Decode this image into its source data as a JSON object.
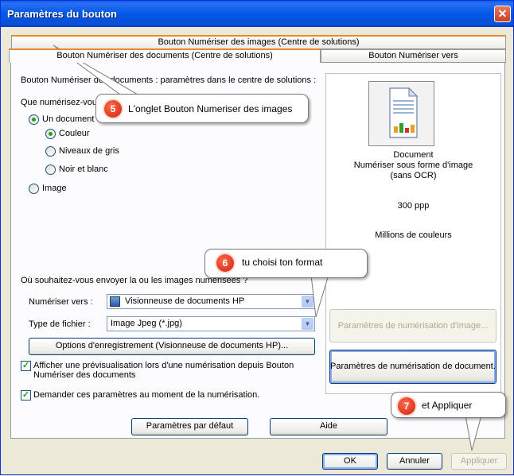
{
  "window": {
    "title": "Paramètres du bouton",
    "close_label": "✕"
  },
  "tabs": {
    "top": "Bouton Numériser des images (Centre de solutions)",
    "selected": "Bouton Numériser des documents (Centre de solutions)",
    "right": "Bouton Numériser vers"
  },
  "panel": {
    "heading": "Bouton Numériser des documents : paramètres dans le centre de solutions :",
    "question": "Que numérisez-vous",
    "radio_document": "Un document",
    "radio_couleur": "Couleur",
    "radio_gris": "Niveaux de gris",
    "radio_noir": "Noir et blanc",
    "radio_image": "Image",
    "send_question": "Où souhaitez-vous envoyer la ou les images numérisées ?",
    "scan_to_label": "Numériser vers :",
    "scan_to_value": "Visionneuse de documents HP",
    "file_type_label": "Type de fichier :",
    "file_type_value": "Image Jpeg (*.jpg)",
    "save_options_button": "Options d'enregistrement (Visionneuse de documents HP)...",
    "preview_check_label_1": "Afficher une prévisualisation lors d'une numérisation depuis Bouton",
    "preview_check_label_2": "Numériser des documents",
    "ask_check_label": "Demander ces paramètres au moment de la numérisation.",
    "defaults_button": "Paramètres par défaut",
    "help_button": "Aide"
  },
  "preview": {
    "line1": "Document",
    "line2": "Numériser sous forme d'image",
    "line3": "(sans OCR)",
    "resolution": "300 ppp",
    "colors": "Millions de couleurs",
    "image_settings_button": "Paramètres de numérisation d'image...",
    "doc_settings_button": "Paramètres de numérisation de document..."
  },
  "footer": {
    "ok": "OK",
    "cancel": "Annuler",
    "apply": "Appliquer"
  },
  "callouts": [
    {
      "number": "5",
      "text": "L'onglet Bouton Numeriser des images"
    },
    {
      "number": "6",
      "text": "tu choisi ton format"
    },
    {
      "number": "7",
      "text": "et Appliquer"
    }
  ],
  "icon_colors": {
    "bar1": "#e8a020",
    "bar2": "#30a030",
    "bar3": "#d03030",
    "accent": "#e68b2c"
  }
}
